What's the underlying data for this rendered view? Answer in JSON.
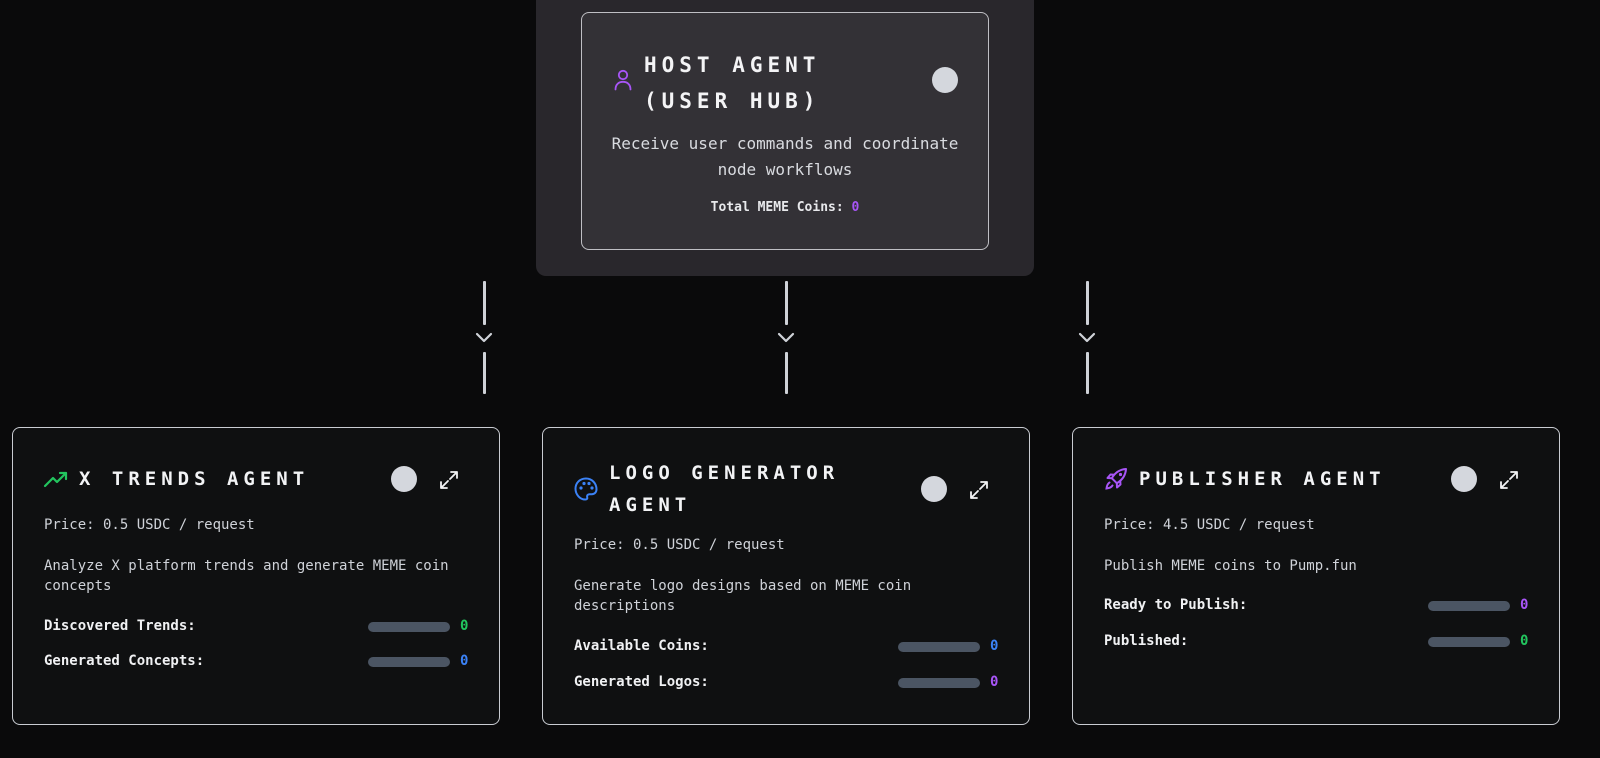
{
  "host": {
    "title": "HOST AGENT (USER HUB)",
    "description": "Receive user commands and coordinate node workflows",
    "total_label": "Total MEME Coins:",
    "total_value": "0",
    "icon": "user-icon"
  },
  "agents": [
    {
      "title": "X TRENDS AGENT",
      "icon": "trending-up-icon",
      "price": "Price: 0.5 USDC / request",
      "description": "Analyze X platform trends and generate MEME coin concepts",
      "stats": [
        {
          "label": "Discovered Trends:",
          "value": "0",
          "color": "#22c55e",
          "progress": 0
        },
        {
          "label": "Generated Concepts:",
          "value": "0",
          "color": "#3b82f6",
          "progress": 0
        }
      ]
    },
    {
      "title": "LOGO GENERATOR AGENT",
      "icon": "palette-icon",
      "price": "Price: 0.5 USDC / request",
      "description": "Generate logo designs based on MEME coin descriptions",
      "stats": [
        {
          "label": "Available Coins:",
          "value": "0",
          "color": "#3b82f6",
          "progress": 0
        },
        {
          "label": "Generated Logos:",
          "value": "0",
          "color": "#a855f7",
          "progress": 0
        }
      ]
    },
    {
      "title": "PUBLISHER AGENT",
      "icon": "rocket-icon",
      "price": "Price: 4.5 USDC / request",
      "description": "Publish MEME coins to Pump.fun",
      "stats": [
        {
          "label": "Ready to Publish:",
          "value": "0",
          "color": "#a855f7",
          "progress": 0
        },
        {
          "label": "Published:",
          "value": "0",
          "color": "#22c55e",
          "progress": 0
        }
      ]
    }
  ],
  "colors": {
    "green": "#22c55e",
    "blue": "#3b82f6",
    "purple": "#a855f7",
    "bar_track": "#4b5563"
  }
}
